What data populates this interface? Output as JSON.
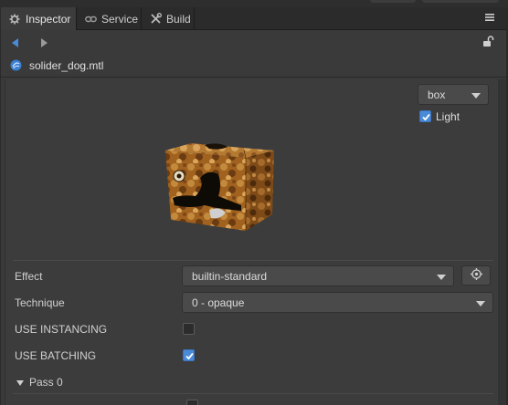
{
  "tabs": [
    {
      "label": "Inspector",
      "icon": "gear-icon",
      "active": true
    },
    {
      "label": "Service",
      "icon": "link-icon",
      "active": false
    },
    {
      "label": "Build",
      "icon": "tools-icon",
      "active": false
    }
  ],
  "header": {
    "menu_icon": "hamburger-menu-icon"
  },
  "nav": {
    "back_icon": "arrow-left-icon",
    "forward_icon": "arrow-right-icon",
    "lock_icon": "unlock-icon"
  },
  "asset": {
    "name": "solider_dog.mtl",
    "icon": "material-icon"
  },
  "preview": {
    "mesh_select": "box",
    "light_label": "Light",
    "light_checked": true,
    "description": "textured cube preview"
  },
  "properties": {
    "effect_label": "Effect",
    "effect_value": "builtin-standard",
    "technique_label": "Technique",
    "technique_value": "0 - opaque",
    "use_instancing_label": "USE INSTANCING",
    "use_instancing_checked": false,
    "use_batching_label": "USE BATCHING",
    "use_batching_checked": true,
    "pass_label": "Pass 0"
  },
  "colors": {
    "accent": "#4a8bd8",
    "panel_bg": "#3c3c3c",
    "tab_bg": "#2b2b2b"
  }
}
